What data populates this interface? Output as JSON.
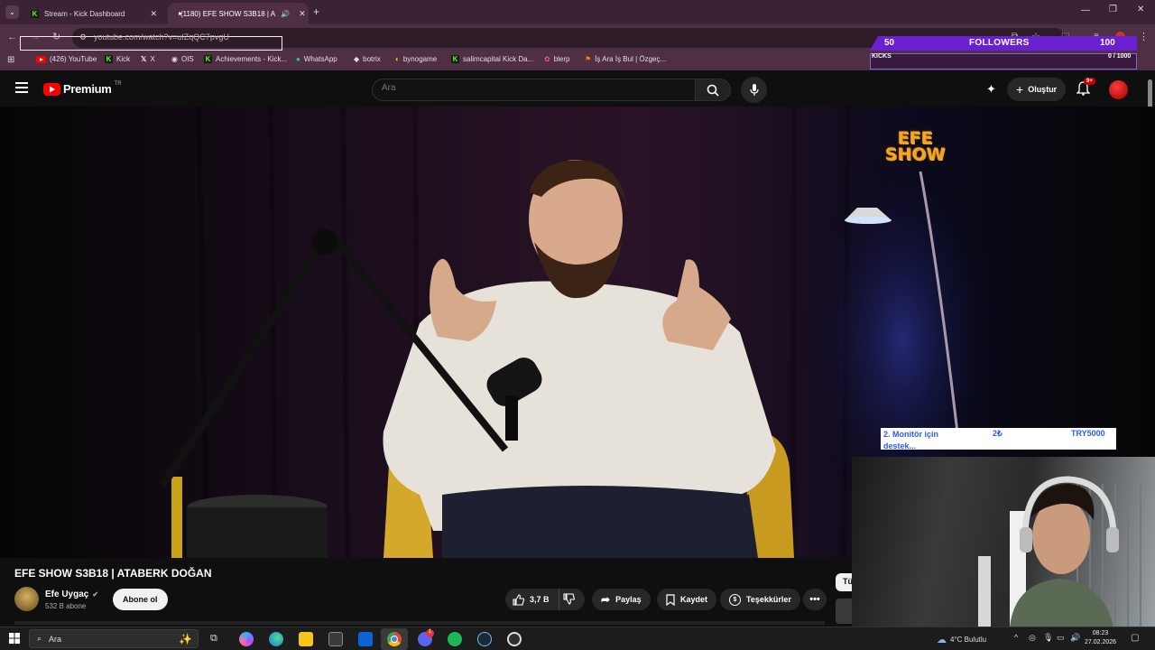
{
  "browser": {
    "tabs": [
      {
        "label": "Stream - Kick Dashboard",
        "icon": "kick-icon",
        "active": false
      },
      {
        "label": "(1180) EFE SHOW S3B18 | A",
        "icon": "youtube-icon",
        "active": true
      }
    ],
    "url": "youtube.com/watch?v=uIZqQC7pvgU",
    "bookmarks": [
      {
        "label": "(426) YouTube",
        "icon": "youtube-icon"
      },
      {
        "label": "Kick",
        "icon": "kick-icon"
      },
      {
        "label": "X",
        "icon": "x-icon"
      },
      {
        "label": "OIS",
        "icon": "globe-icon"
      },
      {
        "label": "Achievements - Kick...",
        "icon": "kick-icon"
      },
      {
        "label": "WhatsApp",
        "icon": "whatsapp-icon"
      },
      {
        "label": "botrix",
        "icon": "botrix-icon"
      },
      {
        "label": "bynogame",
        "icon": "bynogame-icon"
      },
      {
        "label": "salimcapital Kick Da...",
        "icon": "kick-icon"
      },
      {
        "label": "blerp",
        "icon": "blerp-icon"
      },
      {
        "label": "İş Ara İş Bul | Özgeç...",
        "icon": "job-icon"
      }
    ]
  },
  "overlay": {
    "followers_current": "50",
    "followers_label": "FOLLOWERS",
    "followers_goal": "100",
    "kicks_label": "KICKS",
    "kicks_progress": "0 / 1000",
    "kicks_fraction": 0.0,
    "donation_text": "2. Monitör için destek...",
    "donation_amount": "2₺",
    "donation_goal": "TRY5000"
  },
  "youtube": {
    "logo_text": "Premium",
    "logo_region": "TR",
    "search_placeholder": "Ara",
    "create_label": "Oluştur",
    "notifications_badge": "9+",
    "video_watermark_line1": "EFE",
    "video_watermark_line2": "SHOW",
    "video_title": "EFE SHOW S3B18 | ATABERK DOĞAN",
    "channel_name": "Efe Uygaç",
    "subscriber_count": "532 B abone",
    "subscribe_label": "Abone ol",
    "like_count": "3,7 B",
    "share_label": "Paylaş",
    "save_label": "Kaydet",
    "thanks_label": "Teşekkürler",
    "chip_partial": "Tü"
  },
  "taskbar": {
    "search_placeholder": "Ara",
    "weather": "4°C  Bulutlu",
    "time": "08:23",
    "date": "27.02.2026",
    "discord_badge": "1"
  },
  "colors": {
    "tabbar_bg": "#3b2334",
    "toolbar_bg": "#4e2f44",
    "youtube_red": "#ff0000",
    "kick_green": "#53fc18",
    "followers_purple": "#6a1fd1",
    "watermark_orange": "#f5a623"
  }
}
